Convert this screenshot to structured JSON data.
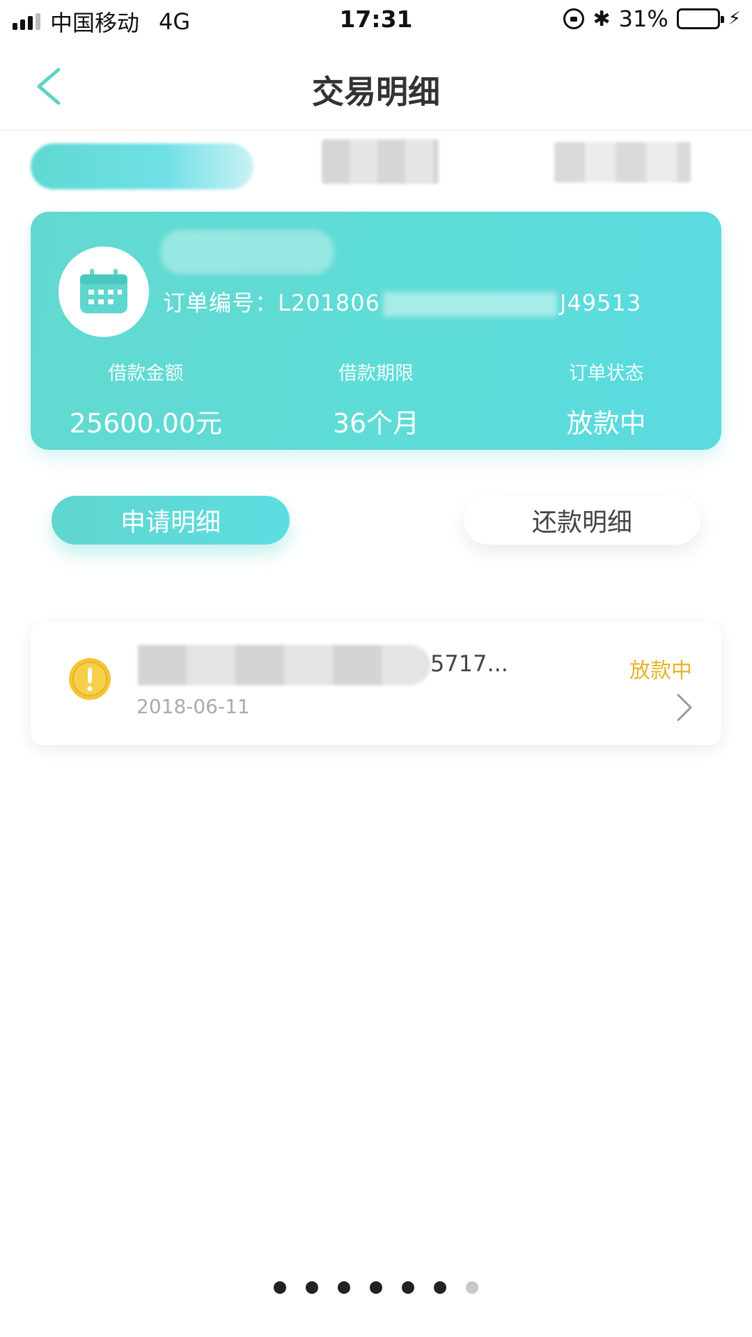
{
  "status_bar": {
    "carrier": "中国移动",
    "network": "4G",
    "time": "17:31",
    "battery": "31%",
    "battery_level": 0.31,
    "icons": [
      "signal-icon",
      "lock-rotation-icon",
      "bluetooth-icon",
      "battery-icon",
      "charging-bolt-icon"
    ]
  },
  "nav": {
    "title": "交易明细",
    "back_icon": "chevron-left-icon"
  },
  "order_card": {
    "icon": "calendar-icon",
    "order_no_prefix": "订单编号：L201806",
    "order_no_suffix": "J49513",
    "stats": [
      {
        "label": "借款金额",
        "value": "25600.00元"
      },
      {
        "label": "借款期限",
        "value": "36个月"
      },
      {
        "label": "订单状态",
        "value": "放款中"
      }
    ]
  },
  "segments": {
    "apply": "申请明细",
    "repay": "还款明细"
  },
  "record": {
    "title_suffix": "5717...",
    "date": "2018-06-11",
    "status": "放款中",
    "icon": "warning-icon"
  },
  "pager": {
    "count": 7,
    "active_index": 6
  },
  "colors": {
    "accent": "#5edcd6",
    "status_pending": "#e8b32b",
    "battery_green": "#4cd964"
  }
}
